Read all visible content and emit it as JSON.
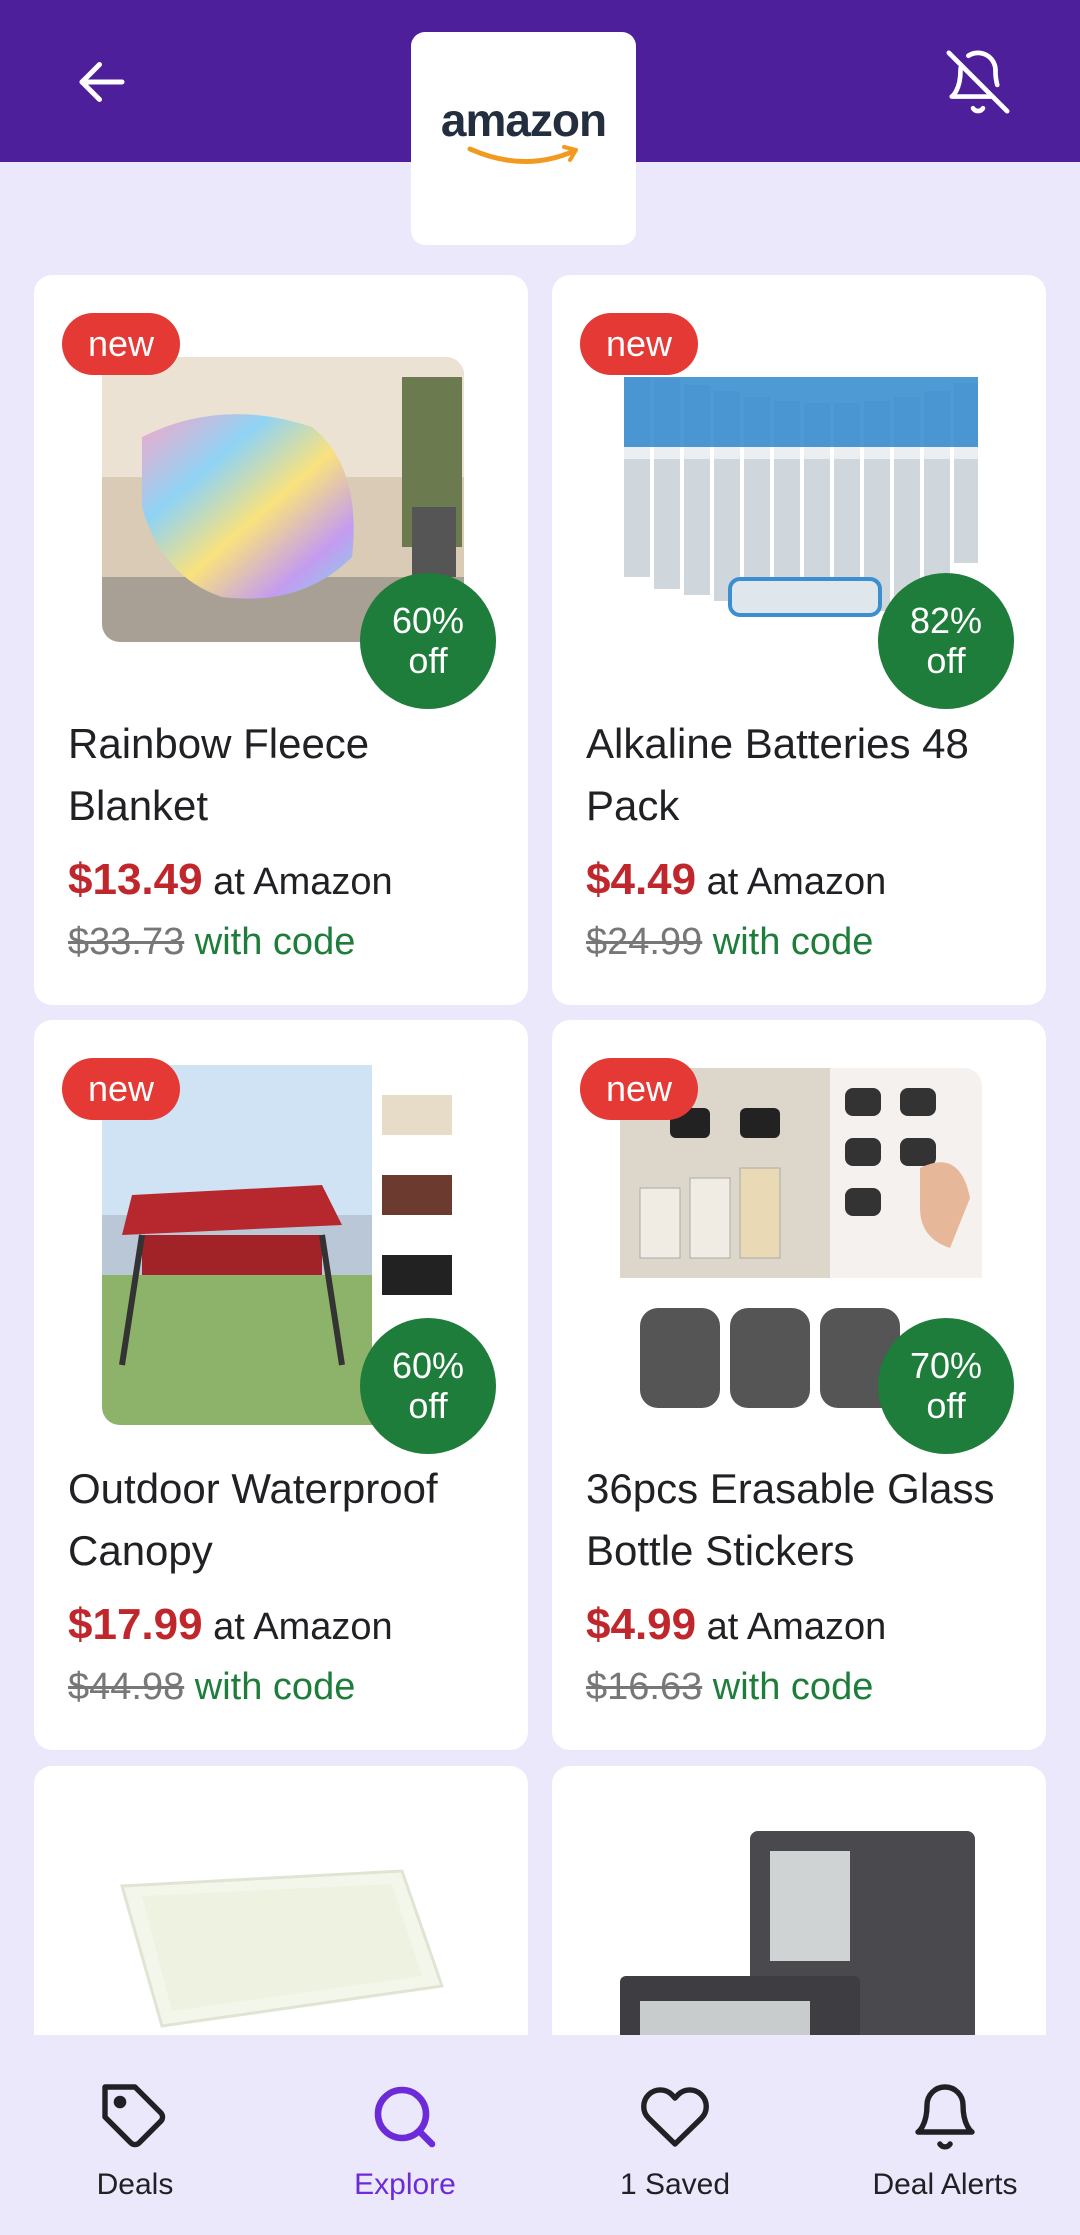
{
  "header": {
    "back_icon": "arrow-left-icon",
    "store_logo_text": "amazon",
    "mute_icon": "bell-off-icon",
    "background": "#4e1f9a"
  },
  "deals": [
    {
      "badge": "new",
      "image_desc": "rainbow fleece blanket on sofa",
      "discount_pct": "60%",
      "discount_suffix": "off",
      "title": "Rainbow Fleece Blanket",
      "price": "$13.49",
      "store_text": "at Amazon",
      "original_price": "$33.73",
      "code_text": "with code"
    },
    {
      "badge": "new",
      "image_desc": "pack of AA alkaline batteries",
      "discount_pct": "82%",
      "discount_suffix": "off",
      "title": "Alkaline Batteries 48 Pack",
      "price": "$4.49",
      "store_text": "at Amazon",
      "original_price": "$24.99",
      "code_text": "with code"
    },
    {
      "badge": "new",
      "image_desc": "outdoor swing with red canopy",
      "discount_pct": "60%",
      "discount_suffix": "off",
      "title": "Outdoor Waterproof Canopy",
      "price": "$17.99",
      "store_text": "at Amazon",
      "original_price": "$44.98",
      "code_text": "with code"
    },
    {
      "badge": "new",
      "image_desc": "black chalkboard label stickers on jars",
      "discount_pct": "70%",
      "discount_suffix": "off",
      "title": "36pcs Erasable Glass Bottle Stickers",
      "price": "$4.99",
      "store_text": "at Amazon",
      "original_price": "$16.63",
      "code_text": "with code"
    },
    {
      "image_desc": "white paper air fryer liner"
    },
    {
      "image_desc": "gray fabric storage organizers"
    }
  ],
  "bottom_nav": [
    {
      "label": "Deals",
      "icon": "tag-icon",
      "active": false
    },
    {
      "label": "Explore",
      "icon": "search-icon",
      "active": true
    },
    {
      "label": "1 Saved",
      "icon": "heart-icon",
      "active": false
    },
    {
      "label": "Deal Alerts",
      "icon": "bell-icon",
      "active": false
    }
  ],
  "colors": {
    "accent": "#6c2bd9",
    "price": "#c0272d",
    "discount": "#1e7d3a",
    "new_badge": "#e53935",
    "page_bg": "#ece8fb"
  }
}
